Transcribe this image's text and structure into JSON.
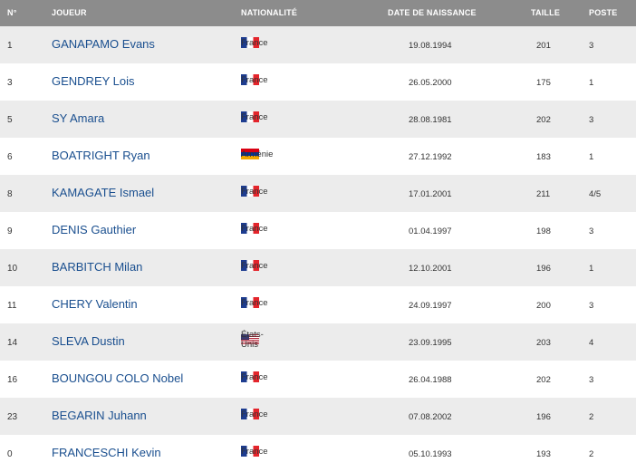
{
  "headers": {
    "num": "N°",
    "player": "JOUEUR",
    "nationality": "NATIONALITÉ",
    "birthdate": "DATE DE NAISSANCE",
    "height": "TAILLE",
    "position": "POSTE"
  },
  "players": [
    {
      "num": "1",
      "name": "GANAPAMO Evans",
      "flag": "france",
      "nationality": "France",
      "birthdate": "19.08.1994",
      "height": "201",
      "position": "3"
    },
    {
      "num": "3",
      "name": "GENDREY Lois",
      "flag": "france",
      "nationality": "France",
      "birthdate": "26.05.2000",
      "height": "175",
      "position": "1"
    },
    {
      "num": "5",
      "name": "SY Amara",
      "flag": "france",
      "nationality": "France",
      "birthdate": "28.08.1981",
      "height": "202",
      "position": "3"
    },
    {
      "num": "6",
      "name": "BOATRIGHT Ryan",
      "flag": "armenia",
      "nationality": "Arménie",
      "birthdate": "27.12.1992",
      "height": "183",
      "position": "1"
    },
    {
      "num": "8",
      "name": "KAMAGATE Ismael",
      "flag": "france",
      "nationality": "France",
      "birthdate": "17.01.2001",
      "height": "211",
      "position": "4/5"
    },
    {
      "num": "9",
      "name": "DENIS Gauthier",
      "flag": "france",
      "nationality": "France",
      "birthdate": "01.04.1997",
      "height": "198",
      "position": "3"
    },
    {
      "num": "10",
      "name": "BARBITCH Milan",
      "flag": "france",
      "nationality": "France",
      "birthdate": "12.10.2001",
      "height": "196",
      "position": "1"
    },
    {
      "num": "11",
      "name": "CHERY Valentin",
      "flag": "france",
      "nationality": "France",
      "birthdate": "24.09.1997",
      "height": "200",
      "position": "3"
    },
    {
      "num": "14",
      "name": "SLEVA Dustin",
      "flag": "usa",
      "nationality": "États-Unis",
      "birthdate": "23.09.1995",
      "height": "203",
      "position": "4"
    },
    {
      "num": "16",
      "name": "BOUNGOU COLO Nobel",
      "flag": "france",
      "nationality": "France",
      "birthdate": "26.04.1988",
      "height": "202",
      "position": "3"
    },
    {
      "num": "23",
      "name": "BEGARIN Juhann",
      "flag": "france",
      "nationality": "France",
      "birthdate": "07.08.2002",
      "height": "196",
      "position": "2"
    },
    {
      "num": "0",
      "name": "FRANCESCHI Kevin",
      "flag": "france",
      "nationality": "France",
      "birthdate": "05.10.1993",
      "height": "193",
      "position": "2"
    }
  ]
}
